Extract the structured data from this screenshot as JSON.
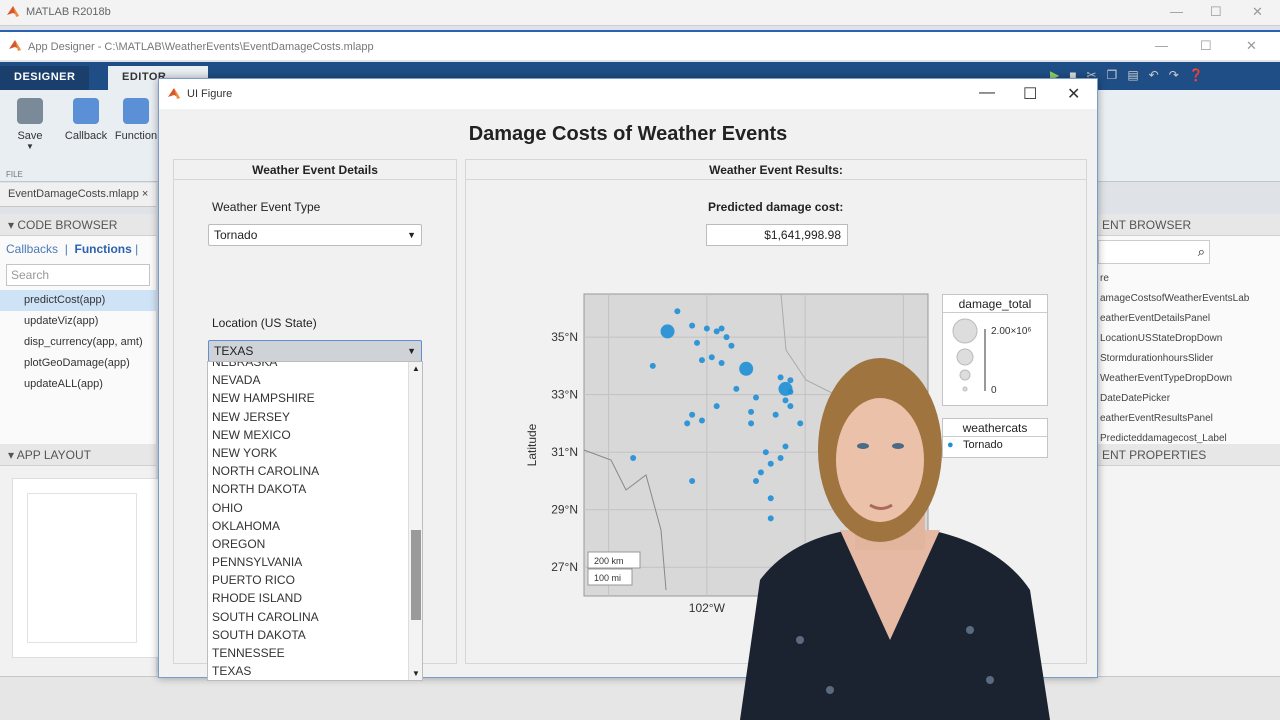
{
  "matlab_window": {
    "title": "MATLAB R2018b"
  },
  "app_designer": {
    "title": "App Designer - C:\\MATLAB\\WeatherEvents\\EventDamageCosts.mlapp",
    "tabs": [
      "DESIGNER",
      "EDITOR"
    ],
    "toolstrip": {
      "save_label": "Save",
      "callback_label": "Callback",
      "function_label": "Function",
      "file_group": "FILE"
    },
    "file_tab": "EventDamageCosts.mlapp ×"
  },
  "code_browser": {
    "header": "CODE BROWSER",
    "tabs": [
      "Callbacks",
      "Functions"
    ],
    "search_placeholder": "Search",
    "functions": [
      "predictCost(app)",
      "updateViz(app)",
      "disp_currency(app, amt)",
      "plotGeoDamage(app)",
      "updateALL(app)"
    ]
  },
  "app_layout": {
    "header": "APP LAYOUT"
  },
  "component_browser": {
    "header": "ENT BROWSER",
    "items": [
      "re",
      "amageCostsofWeatherEventsLab",
      "eatherEventDetailsPanel",
      "LocationUSStateDropDown",
      "StormdurationhoursSlider",
      "WeatherEventTypeDropDown",
      "DateDatePicker",
      "eatherEventResultsPanel",
      "Predicteddamagecost_Label"
    ]
  },
  "component_props": {
    "header": "ENT PROPERTIES"
  },
  "ui_figure": {
    "title": "UI Figure",
    "app_title": "Damage Costs of Weather Events",
    "details_panel": {
      "header": "Weather Event Details",
      "event_type_label": "Weather Event Type",
      "event_type_value": "Tornado",
      "location_label": "Location (US State)",
      "location_value": "TEXAS",
      "location_options": [
        "NEBRASKA",
        "NEVADA",
        "NEW HAMPSHIRE",
        "NEW JERSEY",
        "NEW MEXICO",
        "NEW YORK",
        "NORTH CAROLINA",
        "NORTH DAKOTA",
        "OHIO",
        "OKLAHOMA",
        "OREGON",
        "PENNSYLVANIA",
        "PUERTO RICO",
        "RHODE ISLAND",
        "SOUTH CAROLINA",
        "SOUTH DAKOTA",
        "TENNESSEE",
        "TEXAS"
      ]
    },
    "results_panel": {
      "header": "Weather Event Results:",
      "predicted_label": "Predicted damage cost:",
      "predicted_value": "$1,641,998.98"
    }
  },
  "chart_data": {
    "type": "scatter",
    "ylabel": "Latitude",
    "y_ticks": [
      "35°N",
      "33°N",
      "31°N",
      "29°N",
      "27°N"
    ],
    "x_ticks": [
      "102°W"
    ],
    "scale_labels": [
      "200 km",
      "100 mi"
    ],
    "legend_size": {
      "title": "damage_total",
      "max_label": "2.00×10⁶",
      "min_label": "0"
    },
    "legend_category": {
      "title": "weathercats",
      "entries": [
        "Tornado"
      ]
    },
    "series": [
      {
        "name": "Tornado",
        "color": "#1f8fd6",
        "points": [
          [
            -102.6,
            35.9
          ],
          [
            -102.8,
            35.2
          ],
          [
            -102.3,
            35.4
          ],
          [
            -102.0,
            35.3
          ],
          [
            -101.8,
            35.2
          ],
          [
            -101.7,
            35.3
          ],
          [
            -101.6,
            35.0
          ],
          [
            -102.2,
            34.8
          ],
          [
            -101.5,
            34.7
          ],
          [
            -101.9,
            34.3
          ],
          [
            -101.7,
            34.1
          ],
          [
            -102.1,
            34.2
          ],
          [
            -103.1,
            34.0
          ],
          [
            -101.2,
            33.9
          ],
          [
            -100.5,
            33.6
          ],
          [
            -100.3,
            33.5
          ],
          [
            -100.4,
            33.2
          ],
          [
            -101.4,
            33.2
          ],
          [
            -101.0,
            32.9
          ],
          [
            -101.8,
            32.6
          ],
          [
            -100.3,
            32.6
          ],
          [
            -100.6,
            32.3
          ],
          [
            -101.1,
            32.4
          ],
          [
            -102.3,
            32.3
          ],
          [
            -102.1,
            32.1
          ],
          [
            -102.4,
            32.0
          ],
          [
            -101.1,
            32.0
          ],
          [
            -100.1,
            32.0
          ],
          [
            -100.4,
            31.2
          ],
          [
            -100.8,
            31.0
          ],
          [
            -100.7,
            30.6
          ],
          [
            -100.5,
            30.8
          ],
          [
            -100.9,
            30.3
          ],
          [
            -101.0,
            30.0
          ],
          [
            -103.5,
            30.8
          ],
          [
            -102.3,
            30.0
          ],
          [
            -100.7,
            29.4
          ],
          [
            -100.7,
            28.7
          ],
          [
            -100.3,
            33.1
          ],
          [
            -100.4,
            32.8
          ]
        ]
      }
    ]
  },
  "colors": {
    "accent": "#2b62b5",
    "ribbon": "#1f4e86",
    "marker": "#1f8fd6"
  }
}
